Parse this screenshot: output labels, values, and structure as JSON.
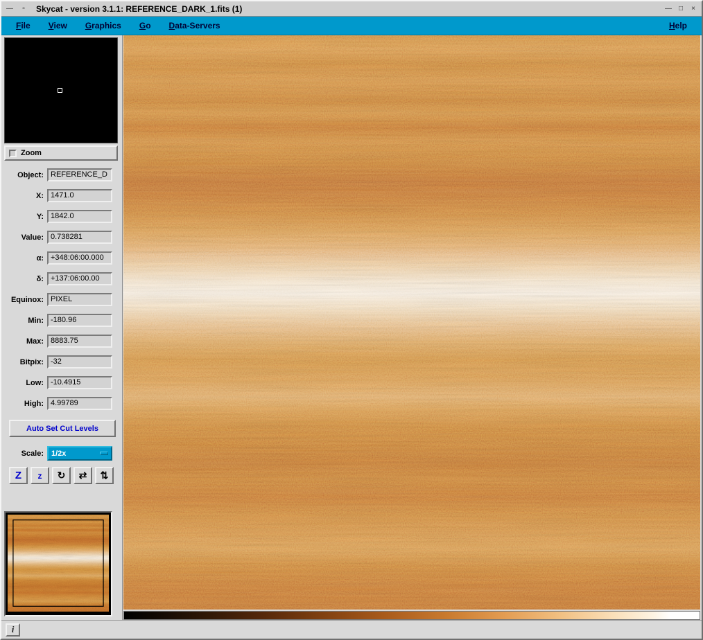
{
  "window": {
    "title": "Skycat - version 3.1.1: REFERENCE_DARK_1.fits (1)",
    "left_buttons": [
      {
        "name": "window-menu",
        "glyph": "—"
      },
      {
        "name": "window-sticky",
        "glyph": "▫"
      }
    ],
    "right_buttons": [
      {
        "name": "minimize",
        "glyph": "—"
      },
      {
        "name": "maximize",
        "glyph": "□"
      },
      {
        "name": "close",
        "glyph": "×"
      }
    ]
  },
  "menubar": {
    "items": [
      {
        "label": "File"
      },
      {
        "label": "View"
      },
      {
        "label": "Graphics"
      },
      {
        "label": "Go"
      },
      {
        "label": "Data-Servers"
      }
    ],
    "help": "Help"
  },
  "panel": {
    "zoom_checkbox_label": "Zoom",
    "fields": [
      {
        "label": "Object:",
        "value": "REFERENCE_D"
      },
      {
        "label": "X:",
        "value": "1471.0"
      },
      {
        "label": "Y:",
        "value": "1842.0"
      },
      {
        "label": "Value:",
        "value": "0.738281"
      },
      {
        "label": "α:",
        "value": "+348:06:00.000"
      },
      {
        "label": "δ:",
        "value": "+137:06:00.00"
      },
      {
        "label": "Equinox:",
        "value": "PIXEL"
      },
      {
        "label": "Min:",
        "value": "-180.96"
      },
      {
        "label": "Max:",
        "value": "8883.75"
      },
      {
        "label": "Bitpix:",
        "value": "-32"
      },
      {
        "label": "Low:",
        "value": "-10.4915"
      },
      {
        "label": "High:",
        "value": "4.99789"
      }
    ],
    "auto_cut_button_label": "Auto Set Cut Levels",
    "scale_label": "Scale:",
    "scale_value": "1/2x",
    "toolbar": {
      "zoom_in": "Z",
      "zoom_out": "z",
      "rotate": "↻",
      "flip_x": "⇄",
      "flip_y": "⇅"
    }
  },
  "statusbar": {
    "info_button_label": "i"
  },
  "colors": {
    "menubar_bg": "#0099cc",
    "accent_blue": "#0000cc",
    "panel_bg": "#d9d9d9",
    "image_base": "#d0803a",
    "image_bright_band": "#fdf2e2",
    "colorbar_left": "#000000",
    "colorbar_right": "#ffffff"
  }
}
